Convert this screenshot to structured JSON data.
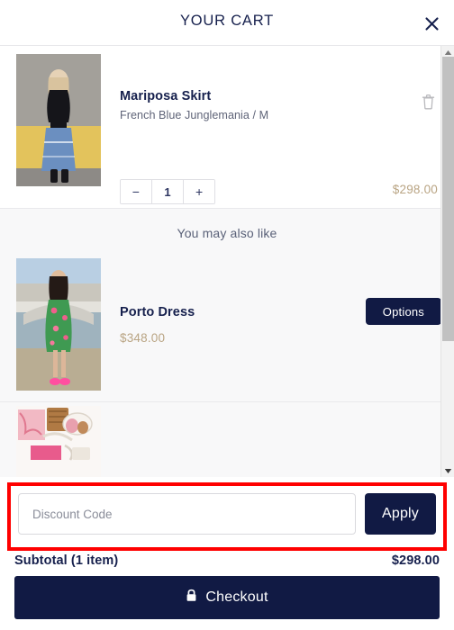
{
  "header": {
    "title": "YOUR CART",
    "close_icon": "close-icon"
  },
  "cart": {
    "items": [
      {
        "title": "Mariposa Skirt",
        "variant": "French Blue Junglemania / M",
        "price": "$298.00",
        "quantity": "1",
        "decrement_label": "−",
        "increment_label": "+",
        "remove_icon": "trash-icon",
        "image_alt": "Model wearing black top and blue Mariposa skirt against yellow wall"
      }
    ]
  },
  "recommendations": {
    "title": "You may also like",
    "items": [
      {
        "title": "Porto Dress",
        "price": "$348.00",
        "button_label": "Options",
        "image_alt": "Model wearing green and pink floral Porto dress by a bridge"
      },
      {
        "title": "",
        "price": "",
        "button_label": "",
        "image_alt": "Flat lay of accessories, sandals and textiles on white background"
      }
    ]
  },
  "discount": {
    "placeholder": "Discount Code",
    "value": "",
    "apply_label": "Apply",
    "highlight_color": "#ff0000"
  },
  "summary": {
    "subtotal_label": "Subtotal (1 item)",
    "subtotal_value": "$298.00"
  },
  "checkout": {
    "label": "Checkout",
    "lock_icon": "lock-icon"
  },
  "scrollbar": {
    "up_icon": "caret-up-icon",
    "down_icon": "caret-down-icon"
  },
  "colors": {
    "navy": "#111a44",
    "gold": "#b9a483",
    "highlight_red": "#ff0000"
  }
}
